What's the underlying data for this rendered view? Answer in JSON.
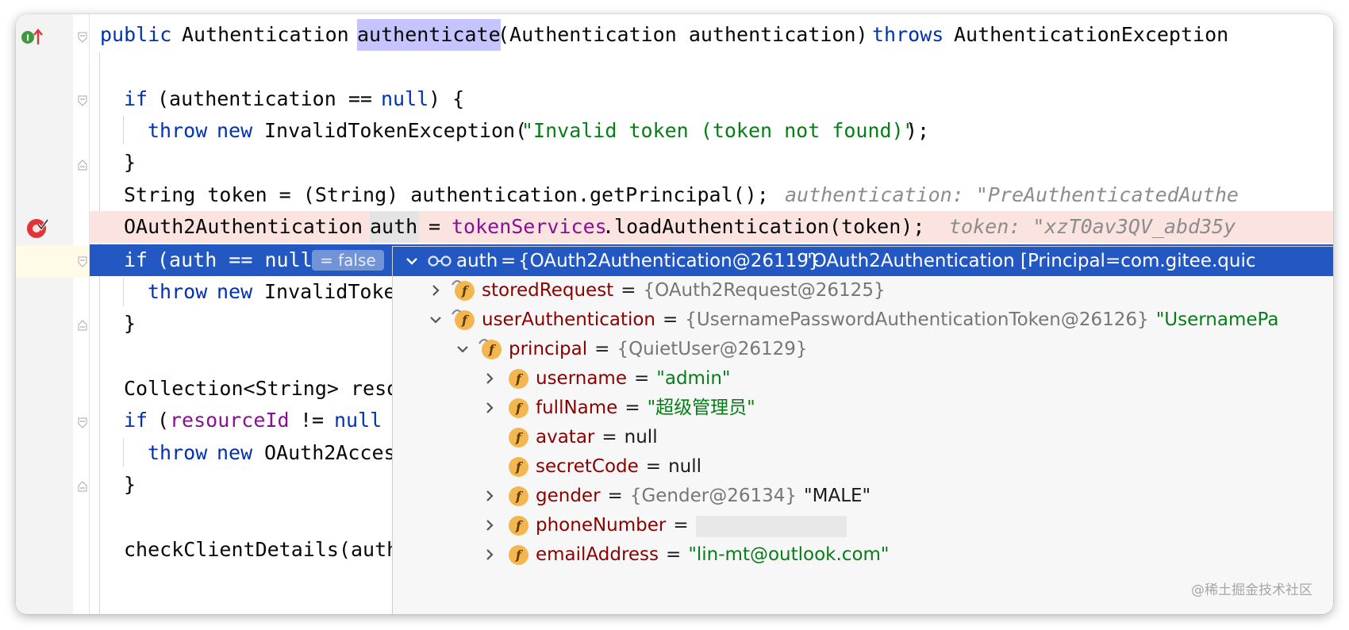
{
  "editor": {
    "lines": {
      "sig_public": "public",
      "sig_type": "Authentication",
      "sig_method": "authenticate",
      "sig_params": "(Authentication authentication)",
      "sig_throws": "throws",
      "sig_exc": "AuthenticationException",
      "if1_kw": "if",
      "if1_cond1": "(authentication ==",
      "if1_null": "null",
      "if1_cond2": ") {",
      "throw1_kw": "throw",
      "throw1_new": "new",
      "throw1_cls": "InvalidTokenException(",
      "throw1_str": "\"Invalid token (token not found)\"",
      "throw1_end": ");",
      "close1": "}",
      "token_line": "String token = (String) authentication.getPrincipal();",
      "token_hint": "authentication: \"PreAuthenticatedAuthe",
      "bp_line_a": "OAuth2Authentication",
      "bp_line_b": "auth",
      "bp_line_c": "=",
      "bp_line_field": "tokenServices",
      "bp_line_d": ".loadAuthentication(token);",
      "bp_hint": "token: \"xzT0av3QV_abd35y",
      "exec_kw": "if",
      "exec_cond": "(auth == null",
      "exec_false": "= false",
      "throw2_kw": "throw",
      "throw2_new": "new",
      "throw2_cls": "InvalidToke",
      "close2": "}",
      "coll_line": "Collection<String> reso",
      "if3_kw": "if",
      "if3_field": "resourceId",
      "if3_rest": "!=",
      "if3_null": "null",
      "if3_open": "(",
      "throw3_kw": "throw",
      "throw3_new": "new",
      "throw3_cls": "OAuth2Acces",
      "close3": "}",
      "check_line": "checkClientDetails(auth"
    }
  },
  "debugger": {
    "root": {
      "name": "auth",
      "eq": "=",
      "ref": "{OAuth2Authentication@26119}",
      "str": "\"OAuth2Authentication [Principal=com.gitee.quic"
    },
    "rows": [
      {
        "name": "storedRequest",
        "ref": "{OAuth2Request@26125}",
        "str": ""
      },
      {
        "name": "userAuthentication",
        "ref": "{UsernamePasswordAuthenticationToken@26126}",
        "str": "\"UsernamePa"
      },
      {
        "name": "principal",
        "ref": "{QuietUser@26129}",
        "str": ""
      },
      {
        "name": "username",
        "ref": "",
        "str": "\"admin\""
      },
      {
        "name": "fullName",
        "ref": "",
        "str": "\"超级管理员\""
      },
      {
        "name": "avatar",
        "ref": "",
        "plain": "null"
      },
      {
        "name": "secretCode",
        "ref": "",
        "plain": "null"
      },
      {
        "name": "gender",
        "ref": "{Gender@26134}",
        "plain": "\"MALE\""
      },
      {
        "name": "phoneNumber",
        "ref": "",
        "plain": ""
      },
      {
        "name": "emailAddress",
        "ref": "",
        "str": "\"lin-mt@outlook.com\""
      }
    ],
    "eq": "=",
    "field_icon_letter": "f"
  },
  "watermark": "@稀土掘金技术社区",
  "colors": {
    "keyword": "#0033b3",
    "string": "#067d17",
    "field": "#871094",
    "selection": "#2357c2",
    "breakpoint": "#e0343a",
    "field_icon": "#f4b64e"
  }
}
